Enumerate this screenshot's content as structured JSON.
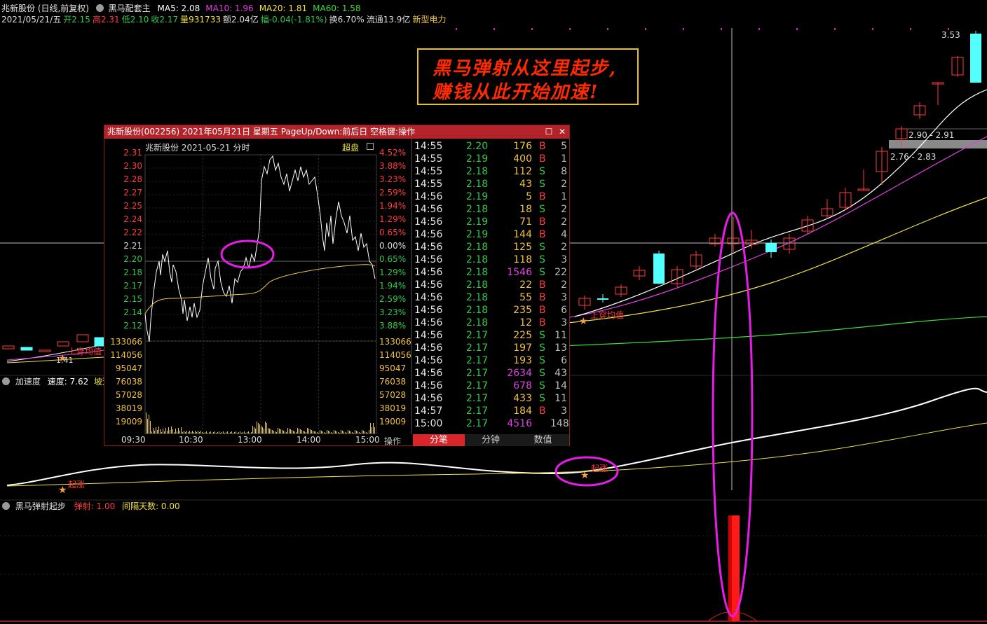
{
  "header": {
    "stock_title": "兆新股份 (日线,前复权)",
    "indicator_name": "黑马配套主",
    "ma": [
      {
        "label": "MA5: 2.08",
        "color": "#ffffff"
      },
      {
        "label": "MA10: 1.96",
        "color": "#e040e0"
      },
      {
        "label": "MA20: 1.81",
        "color": "#f0e040"
      },
      {
        "label": "MA60: 1.58",
        "color": "#3cdc3c"
      }
    ],
    "info_line": [
      {
        "text": "2021/05/21/五",
        "color": "#dddddd"
      },
      {
        "text": "开2.15",
        "color": "#2ec94a"
      },
      {
        "text": "高2.31",
        "color": "#ff3b3b"
      },
      {
        "text": "低2.10",
        "color": "#2ec94a"
      },
      {
        "text": "收2.17",
        "color": "#2ec94a"
      },
      {
        "text": "量931733",
        "color": "#f0e040"
      },
      {
        "text": "额2.04亿",
        "color": "#dddddd"
      },
      {
        "text": "幅-0.04(-1.81%)",
        "color": "#2ec94a"
      },
      {
        "text": "换6.70%",
        "color": "#dddddd"
      },
      {
        "text": "流通13.9亿",
        "color": "#dddddd"
      },
      {
        "text": "新型电力",
        "color": "#f0c040"
      }
    ]
  },
  "main_chart": {
    "price_labels": [
      "3.53",
      "2.90 - 2.91",
      "2.76 - 2.83",
      "1.41"
    ],
    "signal_labels": [
      "上穿均值",
      "上穿均值"
    ]
  },
  "indicator_1": {
    "name": "加速度",
    "speed_label": "速度: 7.62",
    "slope_label": "坡速:",
    "signal_labels": [
      "起涨",
      "起涨"
    ]
  },
  "indicator_2": {
    "name": "黑马弹射起步",
    "eject_label": "弹射: 1.00",
    "gap_label": "间隔天数: 0.00"
  },
  "annotation": {
    "line1": "黑马弹射从这里起步,",
    "line2": "赚钱从此开始加速!"
  },
  "popup": {
    "title": "兆新股份(002256) 2021年05月21日 星期五 PageUp/Down:前后日 空格键:操作",
    "maximize_icon": "maximize-icon",
    "close_icon": "close-icon",
    "chart_title": "兆新股份   2021-05-21  分时",
    "super_label": "超盘",
    "price_axis": [
      "2.31",
      "2.30",
      "2.28",
      "2.27",
      "2.25",
      "2.24",
      "2.22",
      "2.21",
      "2.20",
      "2.18",
      "2.17",
      "2.15",
      "2.14",
      "2.12"
    ],
    "pct_axis": [
      "4.52%",
      "3.88%",
      "3.23%",
      "2.59%",
      "1.94%",
      "1.29%",
      "0.65%",
      "0.00%",
      "0.65%",
      "1.29%",
      "1.94%",
      "2.59%",
      "3.23%",
      "3.88%"
    ],
    "vol_axis": [
      "133066",
      "114056",
      "95047",
      "76038",
      "57028",
      "38019",
      "19009"
    ],
    "time_axis": [
      "09:30",
      "10:30",
      "13:00",
      "14:00",
      "15:00"
    ],
    "op_button": "操作",
    "tabs": [
      "分笔",
      "分钟",
      "数值"
    ],
    "ticks": [
      {
        "time": "14:55",
        "price": "2.20",
        "vol": "176",
        "bs": "B",
        "n": "5"
      },
      {
        "time": "14:55",
        "price": "2.19",
        "vol": "400",
        "bs": "B",
        "n": "1"
      },
      {
        "time": "14:55",
        "price": "2.18",
        "vol": "112",
        "bs": "S",
        "n": "8"
      },
      {
        "time": "14:55",
        "price": "2.18",
        "vol": "43",
        "bs": "S",
        "n": "2"
      },
      {
        "time": "14:56",
        "price": "2.19",
        "vol": "5",
        "bs": "B",
        "n": "1"
      },
      {
        "time": "14:56",
        "price": "2.18",
        "vol": "18",
        "bs": "S",
        "n": "2"
      },
      {
        "time": "14:56",
        "price": "2.19",
        "vol": "71",
        "bs": "B",
        "n": "2"
      },
      {
        "time": "14:56",
        "price": "2.19",
        "vol": "144",
        "bs": "B",
        "n": "4"
      },
      {
        "time": "14:56",
        "price": "2.18",
        "vol": "125",
        "bs": "S",
        "n": "2"
      },
      {
        "time": "14:56",
        "price": "2.18",
        "vol": "118",
        "bs": "S",
        "n": "3"
      },
      {
        "time": "14:56",
        "price": "2.18",
        "vol": "1546",
        "bs": "S",
        "n": "22"
      },
      {
        "time": "14:56",
        "price": "2.18",
        "vol": "22",
        "bs": "B",
        "n": "2"
      },
      {
        "time": "14:56",
        "price": "2.18",
        "vol": "55",
        "bs": "B",
        "n": "3"
      },
      {
        "time": "14:56",
        "price": "2.18",
        "vol": "235",
        "bs": "B",
        "n": "6"
      },
      {
        "time": "14:56",
        "price": "2.18",
        "vol": "12",
        "bs": "B",
        "n": "3"
      },
      {
        "time": "14:56",
        "price": "2.17",
        "vol": "225",
        "bs": "S",
        "n": "11"
      },
      {
        "time": "14:56",
        "price": "2.17",
        "vol": "197",
        "bs": "S",
        "n": "13"
      },
      {
        "time": "14:56",
        "price": "2.17",
        "vol": "193",
        "bs": "S",
        "n": "6"
      },
      {
        "time": "14:56",
        "price": "2.17",
        "vol": "2634",
        "bs": "S",
        "n": "43"
      },
      {
        "time": "14:56",
        "price": "2.17",
        "vol": "678",
        "bs": "S",
        "n": "14"
      },
      {
        "time": "14:56",
        "price": "2.17",
        "vol": "433",
        "bs": "S",
        "n": "11"
      },
      {
        "time": "14:57",
        "price": "2.17",
        "vol": "184",
        "bs": "B",
        "n": "3"
      },
      {
        "time": "15:00",
        "price": "2.17",
        "vol": "4516",
        "bs": "",
        "n": "148"
      }
    ]
  },
  "colors": {
    "up": "#ff3b3b",
    "down": "#54ffff",
    "popup_title_bg": "#b3242a",
    "highlight_ellipse": "#e81ce8"
  }
}
